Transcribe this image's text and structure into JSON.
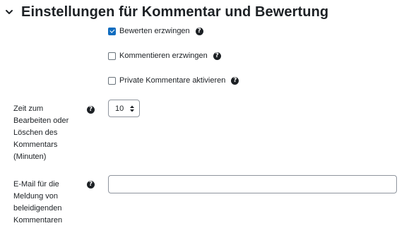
{
  "section": {
    "title": "Einstellungen für Kommentar und Bewertung",
    "icon": "chevron-down-icon"
  },
  "checkboxes": [
    {
      "label": "Bewerten erzwingen",
      "checked": true
    },
    {
      "label": "Kommentieren erzwingen",
      "checked": false
    },
    {
      "label": "Private Kommentare aktivieren",
      "checked": false
    }
  ],
  "help_glyph": "?",
  "edit_time": {
    "label": "Zeit zum Bearbeiten oder Löschen des Kommentars (Minuten)",
    "selected": "10"
  },
  "report_email": {
    "label": "E-Mail für die Meldung von beleidigenden Kommentaren",
    "value": ""
  },
  "colors": {
    "text": "#1d2125",
    "checkbox_checked": "#0f6cbf",
    "input_border": "#8f959e"
  }
}
